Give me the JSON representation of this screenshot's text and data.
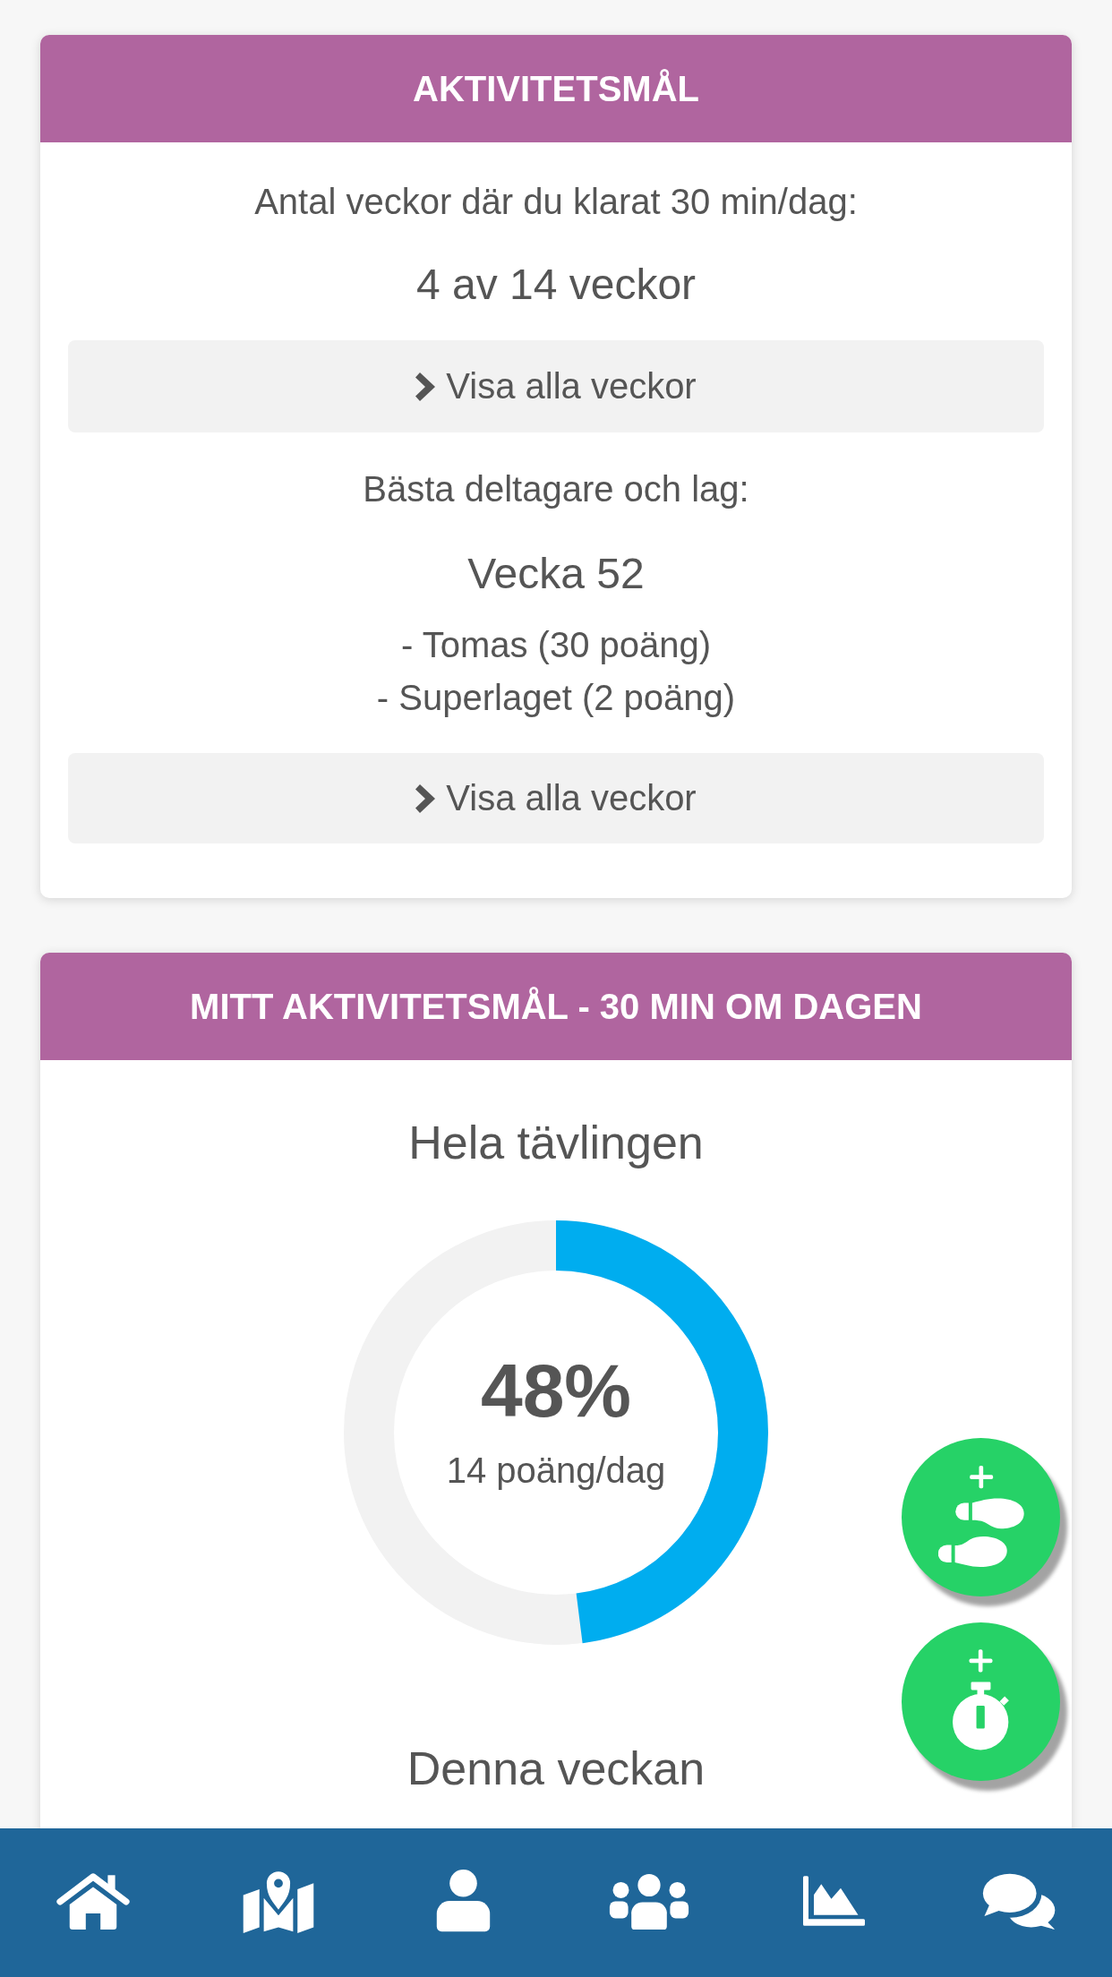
{
  "activity_goal": {
    "title": "AKTIVITETSMÅL",
    "weeks_label": "Antal veckor där du klarat 30 min/dag:",
    "weeks_value": "4 av 14 veckor",
    "weeks_button": "Visa alla veckor",
    "best_label": "Bästa deltagare och lag:",
    "best_week": "Vecka 52",
    "best_entries": [
      "- Tomas (30 poäng)",
      "- Superlaget (2 poäng)"
    ],
    "best_button": "Visa alla veckor"
  },
  "my_goal": {
    "title": "MITT AKTIVITETSMÅL - 30 MIN OM DAGEN",
    "progress": [
      {
        "title": "Hela tävlingen",
        "percent": "48%",
        "rate": "14 poäng/dag",
        "level": 0.48
      },
      {
        "title": "Denna veckan"
      }
    ]
  }
}
